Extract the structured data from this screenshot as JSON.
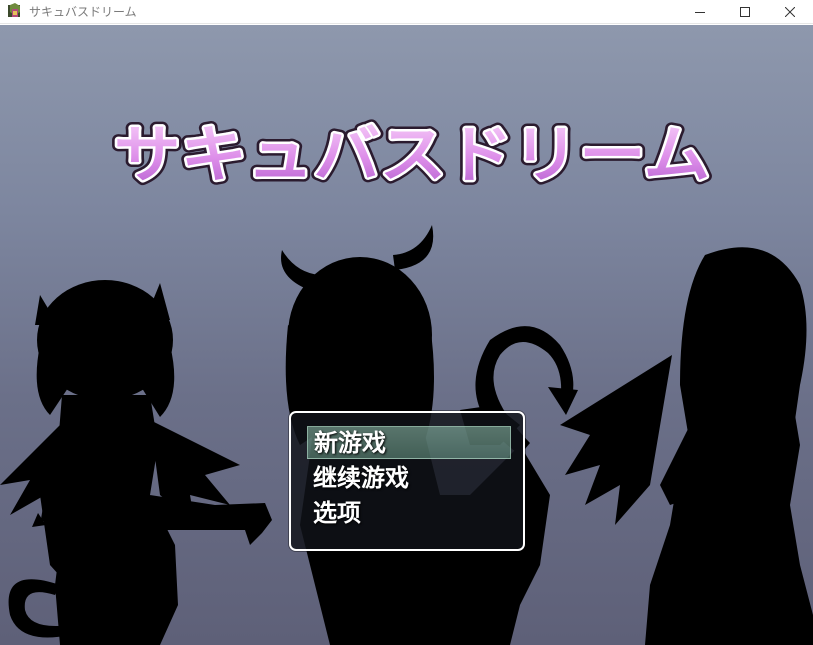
{
  "window": {
    "title": "サキュバスドリーム",
    "minimize_icon": "minimize-icon",
    "maximize_icon": "maximize-icon",
    "close_icon": "close-icon"
  },
  "game": {
    "logo_text": "サキュバスドリーム",
    "logo_color": "#d98be8",
    "background_top": "#8e98ad",
    "background_bottom": "#5e6078"
  },
  "menu": {
    "items": [
      {
        "label": "新游戏",
        "selected": true
      },
      {
        "label": "继续游戏",
        "selected": false
      },
      {
        "label": "选项",
        "selected": false
      }
    ]
  }
}
